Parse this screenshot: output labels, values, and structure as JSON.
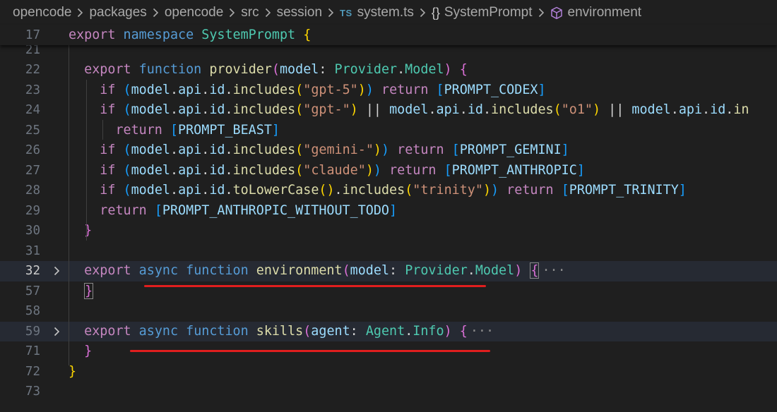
{
  "breadcrumb": {
    "items": [
      {
        "label": "opencode"
      },
      {
        "label": "packages"
      },
      {
        "label": "opencode"
      },
      {
        "label": "src"
      },
      {
        "label": "session"
      },
      {
        "label": "system.ts",
        "icon": "TS"
      },
      {
        "label": "SystemPrompt",
        "icon": "{}"
      },
      {
        "label": "environment",
        "icon": "cube"
      }
    ]
  },
  "colors": {
    "editor_bg": "#1f1f1f",
    "keyword": "#569cd6",
    "function": "#dcdcaa",
    "type": "#4ec9b0",
    "string": "#ce9178",
    "variable": "#9cdcfe",
    "annotation_underline": "#e01e1e"
  },
  "sticky_line": {
    "number": "17",
    "tokens": [
      [
        "export",
        "ctl"
      ],
      [
        " ",
        "pn"
      ],
      [
        "namespace",
        "kw"
      ],
      [
        " ",
        "pn"
      ],
      [
        "SystemPrompt",
        "ty"
      ],
      [
        " ",
        "pn"
      ],
      [
        "{",
        "b1"
      ]
    ]
  },
  "lines": [
    {
      "number": "21",
      "partial": true,
      "tokens": []
    },
    {
      "number": "22",
      "tokens": [
        [
          "  ",
          "pn"
        ],
        [
          "export",
          "ctl"
        ],
        [
          " ",
          "pn"
        ],
        [
          "function",
          "kw"
        ],
        [
          " ",
          "pn"
        ],
        [
          "provider",
          "fn"
        ],
        [
          "(",
          "b2"
        ],
        [
          "model",
          "var"
        ],
        [
          ": ",
          "pn"
        ],
        [
          "Provider",
          "ty"
        ],
        [
          ".",
          "pn"
        ],
        [
          "Model",
          "ty"
        ],
        [
          ")",
          "b2"
        ],
        [
          " ",
          "pn"
        ],
        [
          "{",
          "b2"
        ]
      ]
    },
    {
      "number": "23",
      "tokens": [
        [
          "    ",
          "pn"
        ],
        [
          "if",
          "ctl"
        ],
        [
          " ",
          "pn"
        ],
        [
          "(",
          "b3"
        ],
        [
          "model",
          "var"
        ],
        [
          ".",
          "pn"
        ],
        [
          "api",
          "var"
        ],
        [
          ".",
          "pn"
        ],
        [
          "id",
          "var"
        ],
        [
          ".",
          "pn"
        ],
        [
          "includes",
          "fn"
        ],
        [
          "(",
          "b1"
        ],
        [
          "\"gpt-5\"",
          "str"
        ],
        [
          ")",
          "b1"
        ],
        [
          ")",
          "b3"
        ],
        [
          " ",
          "pn"
        ],
        [
          "return",
          "ctl"
        ],
        [
          " ",
          "pn"
        ],
        [
          "[",
          "b3"
        ],
        [
          "PROMPT_CODEX",
          "var"
        ],
        [
          "]",
          "b3"
        ]
      ]
    },
    {
      "number": "24",
      "tokens": [
        [
          "    ",
          "pn"
        ],
        [
          "if",
          "ctl"
        ],
        [
          " ",
          "pn"
        ],
        [
          "(",
          "b3"
        ],
        [
          "model",
          "var"
        ],
        [
          ".",
          "pn"
        ],
        [
          "api",
          "var"
        ],
        [
          ".",
          "pn"
        ],
        [
          "id",
          "var"
        ],
        [
          ".",
          "pn"
        ],
        [
          "includes",
          "fn"
        ],
        [
          "(",
          "b1"
        ],
        [
          "\"gpt-\"",
          "str"
        ],
        [
          ")",
          "b1"
        ],
        [
          " || ",
          "pn"
        ],
        [
          "model",
          "var"
        ],
        [
          ".",
          "pn"
        ],
        [
          "api",
          "var"
        ],
        [
          ".",
          "pn"
        ],
        [
          "id",
          "var"
        ],
        [
          ".",
          "pn"
        ],
        [
          "includes",
          "fn"
        ],
        [
          "(",
          "b1"
        ],
        [
          "\"o1\"",
          "str"
        ],
        [
          ")",
          "b1"
        ],
        [
          " || ",
          "pn"
        ],
        [
          "model",
          "var"
        ],
        [
          ".",
          "pn"
        ],
        [
          "api",
          "var"
        ],
        [
          ".",
          "pn"
        ],
        [
          "id",
          "var"
        ],
        [
          ".",
          "pn"
        ],
        [
          "in",
          "fn"
        ]
      ]
    },
    {
      "number": "25",
      "tokens": [
        [
          "      ",
          "pn"
        ],
        [
          "return",
          "ctl"
        ],
        [
          " ",
          "pn"
        ],
        [
          "[",
          "b3"
        ],
        [
          "PROMPT_BEAST",
          "var"
        ],
        [
          "]",
          "b3"
        ]
      ]
    },
    {
      "number": "26",
      "tokens": [
        [
          "    ",
          "pn"
        ],
        [
          "if",
          "ctl"
        ],
        [
          " ",
          "pn"
        ],
        [
          "(",
          "b3"
        ],
        [
          "model",
          "var"
        ],
        [
          ".",
          "pn"
        ],
        [
          "api",
          "var"
        ],
        [
          ".",
          "pn"
        ],
        [
          "id",
          "var"
        ],
        [
          ".",
          "pn"
        ],
        [
          "includes",
          "fn"
        ],
        [
          "(",
          "b1"
        ],
        [
          "\"gemini-\"",
          "str"
        ],
        [
          ")",
          "b1"
        ],
        [
          ")",
          "b3"
        ],
        [
          " ",
          "pn"
        ],
        [
          "return",
          "ctl"
        ],
        [
          " ",
          "pn"
        ],
        [
          "[",
          "b3"
        ],
        [
          "PROMPT_GEMINI",
          "var"
        ],
        [
          "]",
          "b3"
        ]
      ]
    },
    {
      "number": "27",
      "tokens": [
        [
          "    ",
          "pn"
        ],
        [
          "if",
          "ctl"
        ],
        [
          " ",
          "pn"
        ],
        [
          "(",
          "b3"
        ],
        [
          "model",
          "var"
        ],
        [
          ".",
          "pn"
        ],
        [
          "api",
          "var"
        ],
        [
          ".",
          "pn"
        ],
        [
          "id",
          "var"
        ],
        [
          ".",
          "pn"
        ],
        [
          "includes",
          "fn"
        ],
        [
          "(",
          "b1"
        ],
        [
          "\"claude\"",
          "str"
        ],
        [
          ")",
          "b1"
        ],
        [
          ")",
          "b3"
        ],
        [
          " ",
          "pn"
        ],
        [
          "return",
          "ctl"
        ],
        [
          " ",
          "pn"
        ],
        [
          "[",
          "b3"
        ],
        [
          "PROMPT_ANTHROPIC",
          "var"
        ],
        [
          "]",
          "b3"
        ]
      ]
    },
    {
      "number": "28",
      "tokens": [
        [
          "    ",
          "pn"
        ],
        [
          "if",
          "ctl"
        ],
        [
          " ",
          "pn"
        ],
        [
          "(",
          "b3"
        ],
        [
          "model",
          "var"
        ],
        [
          ".",
          "pn"
        ],
        [
          "api",
          "var"
        ],
        [
          ".",
          "pn"
        ],
        [
          "id",
          "var"
        ],
        [
          ".",
          "pn"
        ],
        [
          "toLowerCase",
          "fn"
        ],
        [
          "(",
          "b1"
        ],
        [
          ")",
          "b1"
        ],
        [
          ".",
          "pn"
        ],
        [
          "includes",
          "fn"
        ],
        [
          "(",
          "b1"
        ],
        [
          "\"trinity\"",
          "str"
        ],
        [
          ")",
          "b1"
        ],
        [
          ")",
          "b3"
        ],
        [
          " ",
          "pn"
        ],
        [
          "return",
          "ctl"
        ],
        [
          " ",
          "pn"
        ],
        [
          "[",
          "b3"
        ],
        [
          "PROMPT_TRINITY",
          "var"
        ],
        [
          "]",
          "b3"
        ]
      ]
    },
    {
      "number": "29",
      "tokens": [
        [
          "    ",
          "pn"
        ],
        [
          "return",
          "ctl"
        ],
        [
          " ",
          "pn"
        ],
        [
          "[",
          "b3"
        ],
        [
          "PROMPT_ANTHROPIC_WITHOUT_TODO",
          "var"
        ],
        [
          "]",
          "b3"
        ]
      ]
    },
    {
      "number": "30",
      "tokens": [
        [
          "  ",
          "pn"
        ],
        [
          "}",
          "b2"
        ]
      ]
    },
    {
      "number": "31",
      "tokens": []
    },
    {
      "number": "32",
      "folded": true,
      "highlight": true,
      "tokens": [
        [
          "  ",
          "pn"
        ],
        [
          "export",
          "ctl"
        ],
        [
          " ",
          "pn"
        ],
        [
          "async",
          "kw"
        ],
        [
          " ",
          "pn"
        ],
        [
          "function",
          "kw"
        ],
        [
          " ",
          "pn"
        ],
        [
          "environment",
          "fn"
        ],
        [
          "(",
          "b2"
        ],
        [
          "model",
          "var"
        ],
        [
          ": ",
          "pn"
        ],
        [
          "Provider",
          "ty"
        ],
        [
          ".",
          "pn"
        ],
        [
          "Model",
          "ty"
        ],
        [
          ")",
          "b2"
        ],
        [
          " ",
          "pn"
        ],
        [
          "{",
          "b2 bx"
        ],
        [
          "···",
          "ell"
        ]
      ]
    },
    {
      "number": "57",
      "tokens": [
        [
          "  ",
          "pn"
        ],
        [
          "}",
          "b2 bx"
        ]
      ]
    },
    {
      "number": "58",
      "tokens": []
    },
    {
      "number": "59",
      "folded": true,
      "highlight": true,
      "tokens": [
        [
          "  ",
          "pn"
        ],
        [
          "export",
          "ctl"
        ],
        [
          " ",
          "pn"
        ],
        [
          "async",
          "kw"
        ],
        [
          " ",
          "pn"
        ],
        [
          "function",
          "kw"
        ],
        [
          " ",
          "pn"
        ],
        [
          "skills",
          "fn"
        ],
        [
          "(",
          "b2"
        ],
        [
          "agent",
          "var"
        ],
        [
          ": ",
          "pn"
        ],
        [
          "Agent",
          "ty"
        ],
        [
          ".",
          "pn"
        ],
        [
          "Info",
          "ty"
        ],
        [
          ")",
          "b2"
        ],
        [
          " ",
          "pn"
        ],
        [
          "{",
          "b2"
        ],
        [
          "···",
          "ell"
        ]
      ]
    },
    {
      "number": "71",
      "tokens": [
        [
          "  ",
          "pn"
        ],
        [
          "}",
          "b2"
        ]
      ]
    },
    {
      "number": "72",
      "tokens": [
        [
          "}",
          "b1"
        ]
      ]
    },
    {
      "number": "73",
      "tokens": []
    }
  ]
}
